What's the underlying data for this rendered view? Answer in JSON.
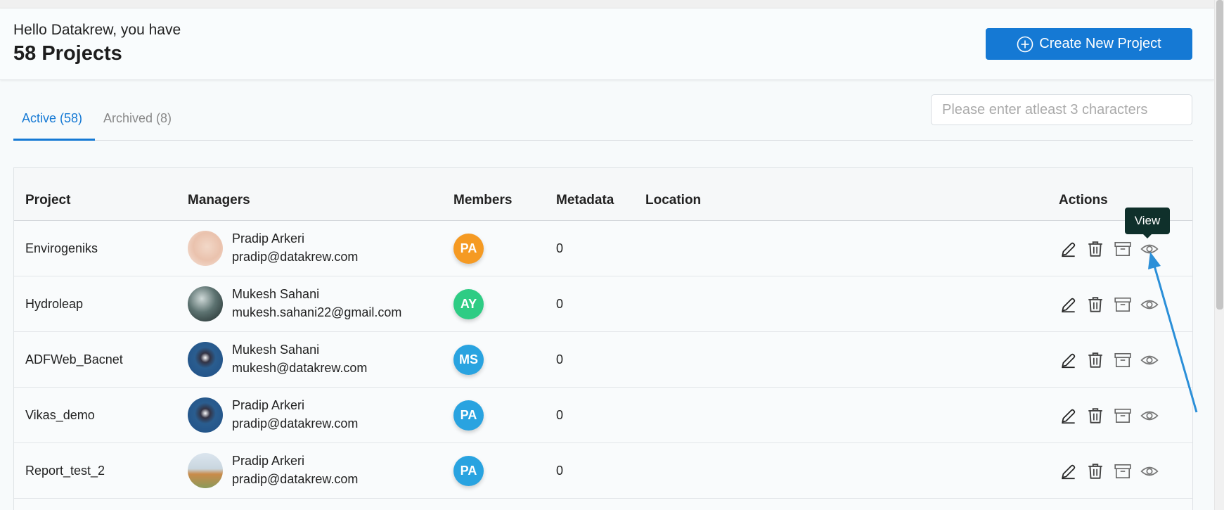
{
  "header": {
    "greeting": "Hello Datakrew, you have",
    "project_count": "58 Projects",
    "create_button": "Create New Project"
  },
  "tabs": [
    {
      "label": "Active (58)",
      "active": true
    },
    {
      "label": "Archived (8)",
      "active": false
    }
  ],
  "search": {
    "placeholder": "Please enter atleast 3 characters",
    "value": ""
  },
  "table": {
    "headers": {
      "project": "Project",
      "managers": "Managers",
      "members": "Members",
      "metadata": "Metadata",
      "location": "Location",
      "actions": "Actions"
    },
    "rows": [
      {
        "project": "Envirogeniks",
        "manager_name": "Pradip Arkeri",
        "manager_email": "pradip@datakrew.com",
        "member_initials": "PA",
        "member_color": "#f59a23",
        "metadata": "0",
        "location": ""
      },
      {
        "project": "Hydroleap",
        "manager_name": "Mukesh Sahani",
        "manager_email": "mukesh.sahani22@gmail.com",
        "member_initials": "AY",
        "member_color": "#2ecc84",
        "metadata": "0",
        "location": ""
      },
      {
        "project": "ADFWeb_Bacnet",
        "manager_name": "Mukesh Sahani",
        "manager_email": "mukesh@datakrew.com",
        "member_initials": "MS",
        "member_color": "#29a3e0",
        "metadata": "0",
        "location": ""
      },
      {
        "project": "Vikas_demo",
        "manager_name": "Pradip Arkeri",
        "manager_email": "pradip@datakrew.com",
        "member_initials": "PA",
        "member_color": "#29a3e0",
        "metadata": "0",
        "location": ""
      },
      {
        "project": "Report_test_2",
        "manager_name": "Pradip Arkeri",
        "manager_email": "pradip@datakrew.com",
        "member_initials": "PA",
        "member_color": "#29a3e0",
        "metadata": "0",
        "location": ""
      }
    ]
  },
  "tooltip": {
    "text": "View"
  },
  "colors": {
    "accent": "#1579d4",
    "tooltip_bg": "#0f302b",
    "arrow": "#2b8fd8"
  },
  "icons": [
    "plus-circle-icon",
    "edit-icon",
    "trash-icon",
    "archive-icon",
    "view-icon"
  ]
}
